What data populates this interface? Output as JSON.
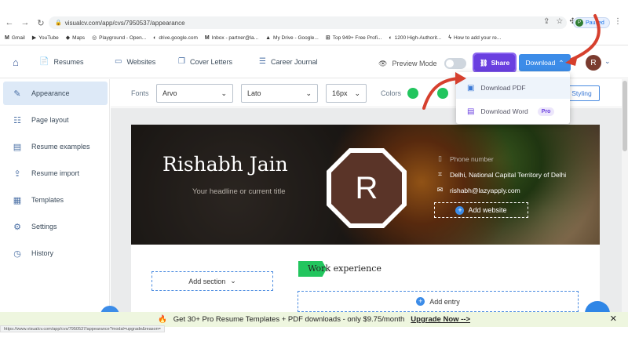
{
  "browser": {
    "url": "visualcv.com/app/cvs/7950537/appearance",
    "profile_status": "Paused",
    "profile_initial": "P",
    "bookmarks": [
      {
        "label": "Gmail",
        "icon": "M"
      },
      {
        "label": "YouTube",
        "icon": "▶"
      },
      {
        "label": "Maps",
        "icon": "◆"
      },
      {
        "label": "Playground - Open...",
        "icon": "◎"
      },
      {
        "label": "drive.google.com",
        "icon": "◐"
      },
      {
        "label": "Inbox - partner@la...",
        "icon": "M"
      },
      {
        "label": "My Drive - Google...",
        "icon": "▲"
      },
      {
        "label": "Top 949+ Free Profi...",
        "icon": "⊞"
      },
      {
        "label": "1200 High-Authorit...",
        "icon": "◐"
      },
      {
        "label": "How to add your re...",
        "icon": "ϟ"
      }
    ]
  },
  "header": {
    "nav": [
      {
        "label": "Resumes",
        "icon": "📄"
      },
      {
        "label": "Websites",
        "icon": "▭"
      },
      {
        "label": "Cover Letters",
        "icon": "❐"
      },
      {
        "label": "Career Journal",
        "icon": "☰"
      }
    ],
    "preview_label": "Preview Mode",
    "preview_enabled": false,
    "share_label": "Share",
    "download_label": "Download",
    "avatar_initial": "R"
  },
  "sidebar": {
    "items": [
      {
        "label": "Appearance",
        "icon": "✎",
        "active": true
      },
      {
        "label": "Page layout",
        "icon": "☷",
        "active": false
      },
      {
        "label": "Resume examples",
        "icon": "▤",
        "active": false
      },
      {
        "label": "Resume import",
        "icon": "⇪",
        "active": false
      },
      {
        "label": "Templates",
        "icon": "▦",
        "active": false
      },
      {
        "label": "Settings",
        "icon": "⚙",
        "active": false
      },
      {
        "label": "History",
        "icon": "◷",
        "active": false
      }
    ]
  },
  "format": {
    "fonts_label": "Fonts",
    "font_primary": "Arvo",
    "font_secondary": "Lato",
    "font_size": "16px",
    "colors_label": "Colors",
    "color_accent": "#22c55e",
    "styling_label": "Styling"
  },
  "download_menu": {
    "pdf_label": "Download PDF",
    "word_label": "Download Word",
    "word_badge": "Pro"
  },
  "resume": {
    "name": "Rishabh Jain",
    "headline_placeholder": "Your headline or current title",
    "photo_initial": "R",
    "phone_placeholder": "Phone number",
    "location": "Delhi, National Capital Territory of Delhi",
    "email": "rishabh@lazyapply.com",
    "add_website_label": "Add website",
    "add_section_label": "Add section",
    "work_title": "Work experience",
    "add_entry_label": "Add entry"
  },
  "promo": {
    "text": "Get 30+ Pro Resume Templates + PDF downloads - only $9.75/month",
    "cta": "Upgrade Now -->",
    "icon": "🔥"
  },
  "status_url": "https://www.visualcv.com/app/cvs/7950537/appearance?modal=upgrade&reason="
}
